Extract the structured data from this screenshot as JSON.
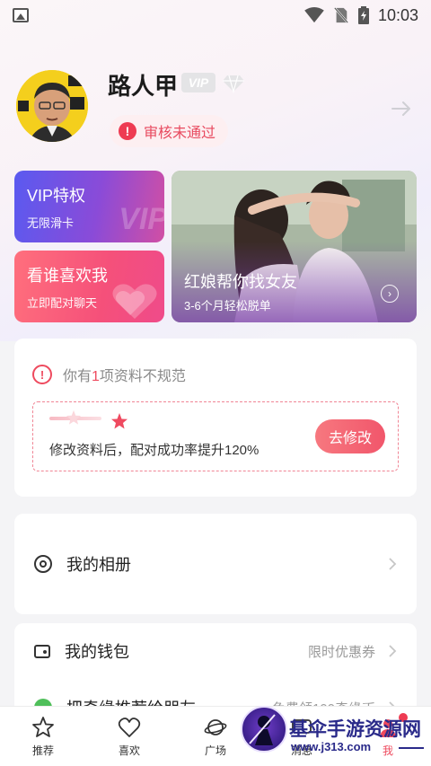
{
  "status_bar": {
    "time": "10:03"
  },
  "profile": {
    "username": "路人甲",
    "vip_badge": "VIP",
    "review_status": "审核未通过"
  },
  "features": {
    "vip": {
      "title": "VIP特权",
      "subtitle": "无限滑卡",
      "watermark": "VIP"
    },
    "likes": {
      "title": "看谁喜欢我",
      "subtitle": "立即配对聊天"
    },
    "matchmaker": {
      "title": "红娘帮你找女友",
      "subtitle": "3-6个月轻松脱单"
    }
  },
  "notice": {
    "prefix": "你有",
    "count": "1",
    "suffix": "项资料不规范",
    "message": "修改资料后，配对成功率提升120%",
    "button": "去修改"
  },
  "menu": {
    "album": {
      "label": "我的相册"
    },
    "wallet": {
      "label": "我的钱包",
      "extra": "限时优惠券"
    },
    "share": {
      "label": "把奇缘推荐给朋友",
      "extra": "免费领100奇缘币"
    }
  },
  "bottom_nav": {
    "items": [
      {
        "label": "推荐",
        "icon": "star-icon"
      },
      {
        "label": "喜欢",
        "icon": "heart-icon"
      },
      {
        "label": "广场",
        "icon": "planet-icon"
      },
      {
        "label": "消息",
        "icon": "message-icon"
      },
      {
        "label": "我",
        "icon": "user-icon",
        "active": true
      }
    ]
  },
  "watermark": {
    "site_name": "基伞手游资源网",
    "url": "www.j313.com"
  },
  "colors": {
    "accent": "#ee4a5e",
    "vip_gradient_start": "#5a5af0",
    "vip_gradient_end": "#d14fa4",
    "likes_gradient_start": "#ff6f7d",
    "likes_gradient_end": "#ef4b8a"
  }
}
